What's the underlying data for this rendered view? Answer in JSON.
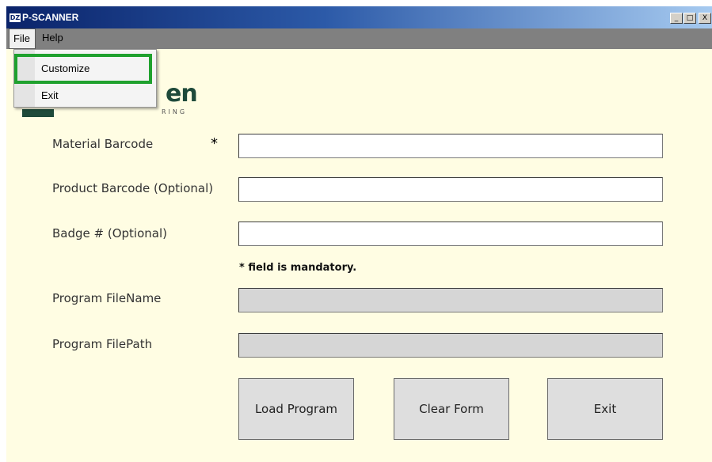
{
  "window": {
    "icon_text": "DZ",
    "title": "P-SCANNER",
    "controls": {
      "minimize": "_",
      "maximize": "□",
      "close": "X"
    }
  },
  "menubar": {
    "file": "File",
    "help": "Help"
  },
  "file_menu": {
    "items": [
      "Customize",
      "Exit"
    ],
    "highlight_color": "#1fa12e"
  },
  "logo": {
    "text": "en",
    "subtext": "RING"
  },
  "form": {
    "material_barcode_label": "Material Barcode",
    "required_marker": "*",
    "product_barcode_label": "Product Barcode (Optional)",
    "badge_label": "Badge # (Optional)",
    "mandatory_note": "* field is mandatory.",
    "program_filename_label": "Program FileName",
    "program_filepath_label": "Program FilePath",
    "material_barcode_value": "",
    "product_barcode_value": "",
    "badge_value": "",
    "program_filename_value": "",
    "program_filepath_value": ""
  },
  "buttons": {
    "load_program": "Load Program",
    "clear_form": "Clear Form",
    "exit": "Exit"
  },
  "colors": {
    "background": "#fffde3",
    "titlebar_start": "#0a236a",
    "menubar": "#808080",
    "readonly_field": "#d6d6d6"
  }
}
